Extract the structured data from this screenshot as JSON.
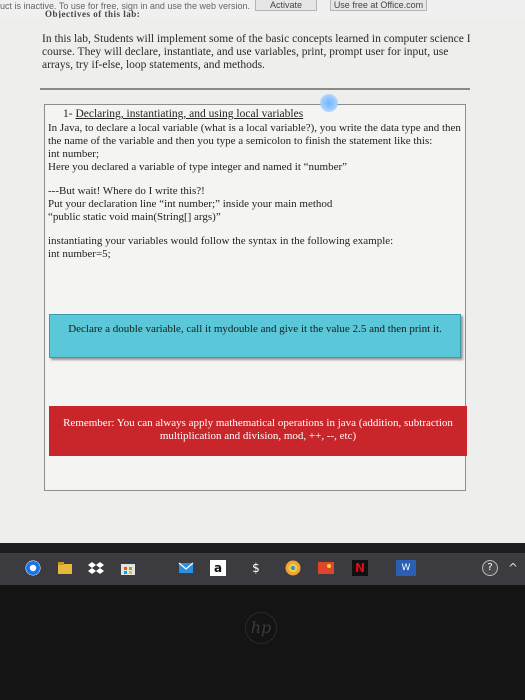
{
  "banner": {
    "message": "uct is inactive. To use for free, sign in and use the web version.",
    "activate_label": "Activate",
    "office_label": "Use free at Office.com",
    "objectives": "Objectives of this lab:"
  },
  "document": {
    "intro": "In this lab, Students will implement some of the basic concepts learned in computer science I course. They will declare, instantiate, and use variables, print, prompt user for input, use arrays, try if-else, loop statements, and methods.",
    "section_number": "1-",
    "section_title": "Declaring, instantiating, and using local variables",
    "lines": [
      "In Java, to declare a local variable (what is a local variable?), you write the data type and then the name of the variable and then you type a semicolon to finish the statement like this:",
      "int number;",
      "Here you declared a variable of type integer and named it “number”",
      "---But wait! Where do I write this?!",
      "Put your declaration line “int number;” inside your main method",
      "“public static void main(String[] args)”",
      "instantiating your variables would follow the syntax in the following example:",
      "int number=5;"
    ],
    "task_box": "Declare a double variable, call it mydouble and give it the value 2.5 and then print it.",
    "reminder_box": "Remember: You can always apply mathematical operations in java (addition, subtraction multiplication and division, mod, ++, --, etc)"
  },
  "taskbar": {
    "icons": [
      "chrome-icon",
      "file-explorer-icon",
      "dropbox-icon",
      "store-icon",
      "mail-icon",
      "amazon-icon",
      "dollar-icon",
      "spotify-icon",
      "photos-icon",
      "netflix-icon",
      "word-icon",
      "help-icon",
      "chevron-up-icon"
    ],
    "amazon_glyph": "a",
    "dollar_glyph": "$",
    "netflix_glyph": "N",
    "word_glyph": "W",
    "help_glyph": "?",
    "chevron_glyph": "^"
  },
  "laptop": {
    "logo_text": "hp"
  },
  "colors": {
    "task_box": "#5ac8d8",
    "reminder_box": "#c8262b",
    "taskbar": "#3c3c40"
  }
}
